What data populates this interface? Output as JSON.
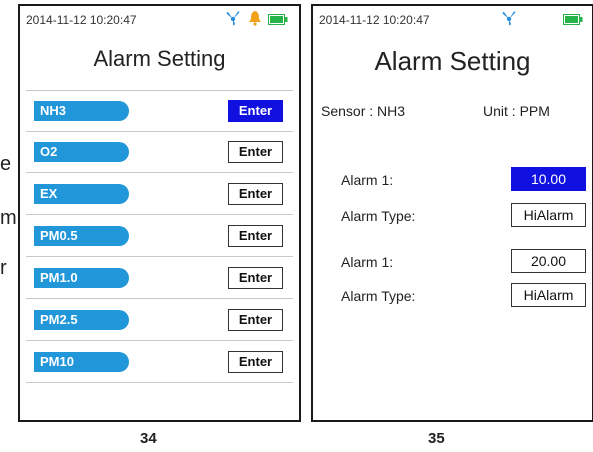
{
  "side_text": [
    "e",
    "m",
    "r"
  ],
  "screen_left": {
    "datetime": "2014-11-12  10:20:47",
    "title": "Alarm Setting",
    "sensors": [
      {
        "name": "NH3",
        "button": "Enter",
        "selected": true
      },
      {
        "name": "O2",
        "button": "Enter",
        "selected": false
      },
      {
        "name": "EX",
        "button": "Enter",
        "selected": false
      },
      {
        "name": "PM0.5",
        "button": "Enter",
        "selected": false
      },
      {
        "name": "PM1.0",
        "button": "Enter",
        "selected": false
      },
      {
        "name": "PM2.5",
        "button": "Enter",
        "selected": false
      },
      {
        "name": "PM10",
        "button": "Enter",
        "selected": false
      }
    ],
    "page_number": "34",
    "icons": [
      "fan-icon",
      "bell-icon",
      "battery-icon"
    ]
  },
  "screen_right": {
    "datetime": "2014-11-12  10:20:47",
    "title": "Alarm Setting",
    "sensor_label": "Sensor : NH3",
    "unit_label": "Unit : PPM",
    "alarms": [
      {
        "label": "Alarm  1:",
        "value": "10.00",
        "selected": true,
        "type_label": "Alarm Type:",
        "type_value": "HiAlarm"
      },
      {
        "label": "Alarm  1:",
        "value": "20.00",
        "selected": false,
        "type_label": "Alarm Type:",
        "type_value": "HiAlarm"
      }
    ],
    "page_number": "35",
    "icons": [
      "fan-icon",
      "battery-icon"
    ]
  },
  "colors": {
    "pill": "#2196d9",
    "selected": "#1010e0",
    "fan": "#2a8fdc",
    "bell": "#f2a21a",
    "battery": "#27b34a"
  }
}
